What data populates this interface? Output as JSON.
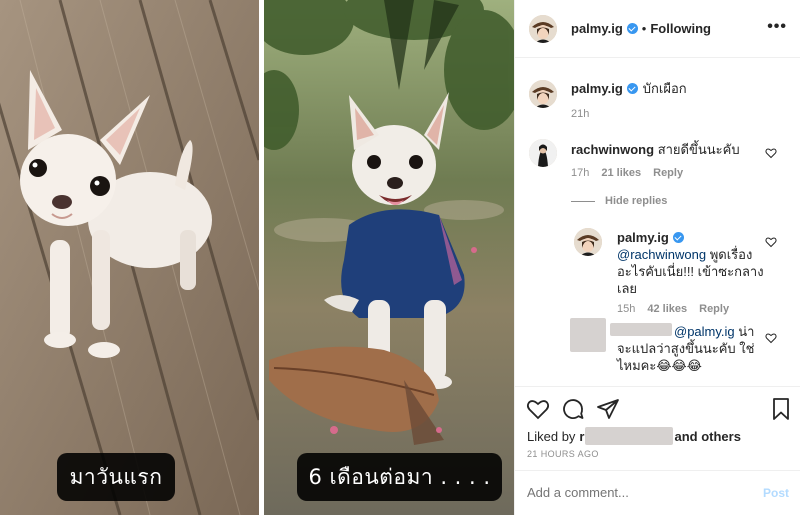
{
  "photos": {
    "left_caption": "มาวันแรก",
    "right_caption": "6  เดือนต่อมา . . . ."
  },
  "header": {
    "username": "palmy.ig",
    "separator": "•",
    "follow_state": "Following",
    "more": "•••"
  },
  "post_caption": {
    "username": "palmy.ig",
    "text": "บักเผือก",
    "time": "21h"
  },
  "comments": [
    {
      "username": "rachwinwong",
      "text": "สายดีขึ้นนะคับ",
      "time": "17h",
      "likes": "21 likes",
      "reply": "Reply"
    }
  ],
  "hide_replies": "Hide replies",
  "replies": [
    {
      "username": "palmy.ig",
      "mention": "@rachwinwong",
      "text_line1": "พูดเรื่อง",
      "text_line2": "อะไรคับเนี่ย!!! เข้าซะกลาง",
      "text_line3": "เลย",
      "time": "15h",
      "likes": "42 likes",
      "reply": "Reply"
    },
    {
      "mention": "@palmy.ig",
      "text_line1": "น่า",
      "text_line2": "จะแปลว่าสูงขึ้นนะคับ ใช่",
      "text_line3": "ไหมคะ😂😂😂"
    }
  ],
  "footer": {
    "liked_by_prefix": "Liked by",
    "liked_by_initial": "r",
    "and_others": "and others",
    "timestamp": "21 HOURS AGO",
    "add_comment_placeholder": "Add a comment...",
    "post_label": "Post"
  },
  "colors": {
    "verified": "#3897f0",
    "link": "#003569",
    "post_disabled": "#b3dbff",
    "muted": "#8e8e8e"
  },
  "icons": [
    "heart-icon",
    "comment-icon",
    "share-icon",
    "bookmark-icon",
    "more-icon",
    "verified-icon"
  ]
}
